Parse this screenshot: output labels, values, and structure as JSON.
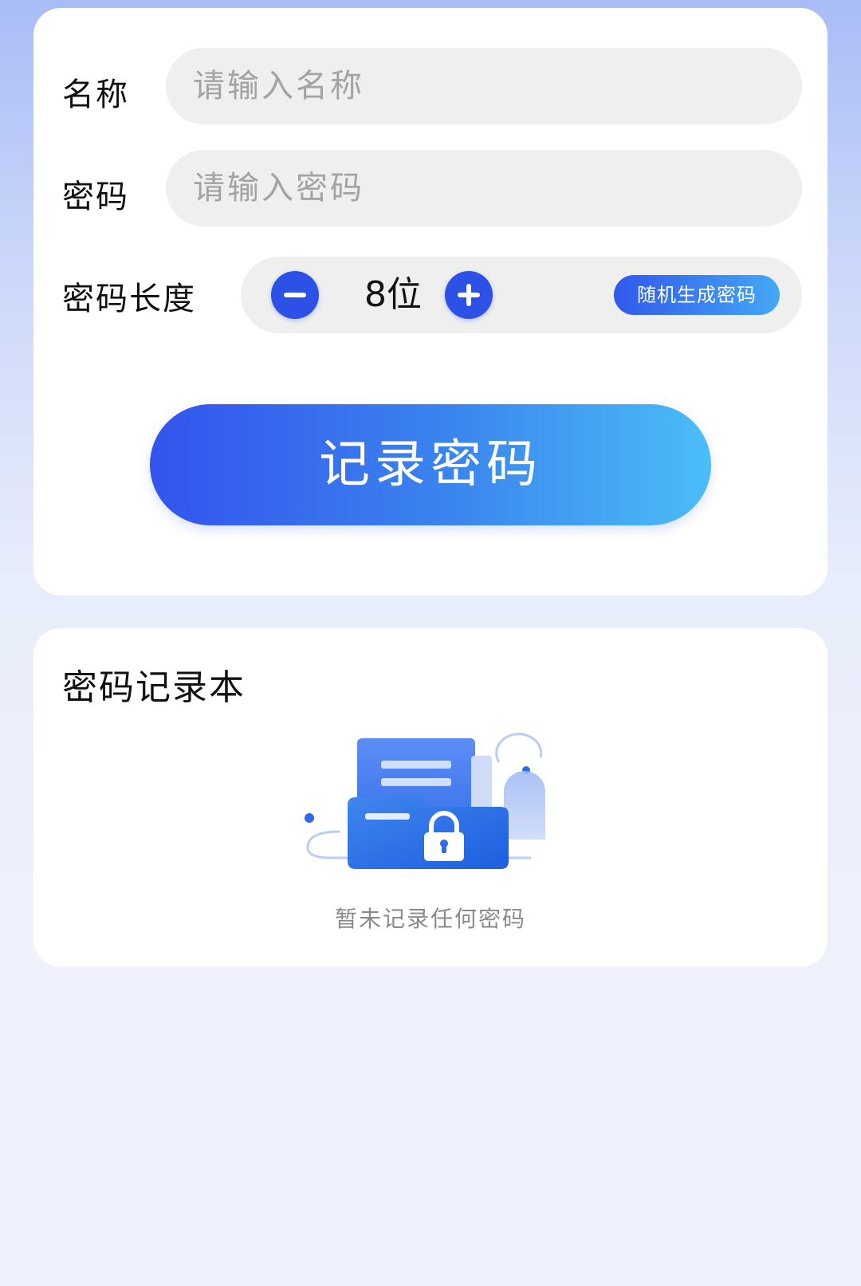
{
  "form": {
    "name_label": "名称",
    "name_placeholder": "请输入名称",
    "password_label": "密码",
    "password_placeholder": "请输入密码",
    "length_label": "密码长度",
    "length_value": "8位",
    "generate_label": "随机生成密码",
    "record_label": "记录密码"
  },
  "records": {
    "title": "密码记录本",
    "empty_text": "暂未记录任何密码"
  },
  "icons": {
    "decrease": "minus-icon",
    "increase": "plus-icon",
    "empty": "locked-folder-icon"
  },
  "colors": {
    "accent": "#2d50e6",
    "gradient_start": "#3453ee",
    "gradient_end": "#4bbdf8"
  }
}
